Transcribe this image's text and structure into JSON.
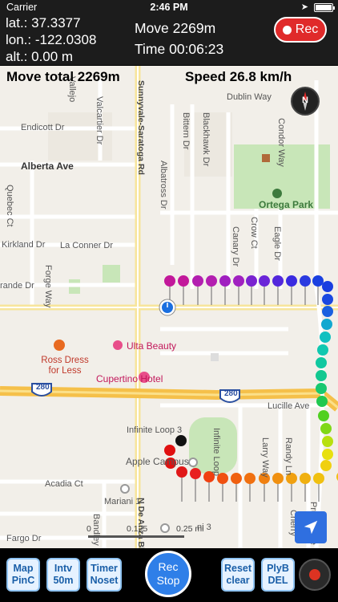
{
  "status_bar": {
    "carrier": "Carrier",
    "time": "2:46 PM"
  },
  "gps": {
    "lat": "lat.: 37.3377",
    "lon": "lon.: -122.0308",
    "alt": "alt.: 0.00 m"
  },
  "session": {
    "move": "Move 2269m",
    "time": "Time 00:06:23",
    "move_total": "Move total 2269m",
    "speed": "Speed 26.8 km/h"
  },
  "rec_button": {
    "label": "Rec"
  },
  "compass": {
    "label": "N"
  },
  "scale": {
    "l0": "0",
    "l1": "0.125",
    "l2": "0.25 mi"
  },
  "map": {
    "streets": {
      "endicott": "Endicott Dr",
      "alberta": "Alberta Ave",
      "kirkland": "Kirkland Dr",
      "la_conner": "La Conner Dr",
      "grande": "rande Dr",
      "quebec": "Quebec Ct",
      "forge": "Forge Way",
      "vallejo": "Vallejo",
      "valcartier": "Valcartier Dr",
      "sunnyvale_saratoga": "Sunnyvale-Saratoga Rd",
      "albatross": "Albatross Dr",
      "bittern": "Bittern Dr",
      "blackhawk": "Blackhawk Dr",
      "dublin": "Dublin Way",
      "condor": "Condor Way",
      "crow": "Crow Ct",
      "canary": "Canary Dr",
      "eagle": "Eagle Dr",
      "lucille": "Lucille Ave",
      "acadia": "Acadia Ct",
      "mariani": "Mariani 1",
      "infinite_loop_3": "Infinite Loop 3",
      "infinite_loop": "Infinite Loop",
      "apple_campus": "Apple Campus",
      "fargo": "Fargo Dr",
      "bandley": "Bandley Dr",
      "de_anza": "N De Anza Blvd",
      "larry": "Larry Way",
      "randy": "Randy Ln",
      "cherry": "Cherry",
      "pruneridge": "Pruneridge",
      "hwy": "280",
      "hwy2": "280",
      "mariani3": "ni 3"
    },
    "pois": {
      "ortega_park": "Ortega Park",
      "ross": "Ross Dress for Less",
      "ulta": "Ulta Beauty",
      "cupertino_hotel": "Cupertino Hotel"
    }
  },
  "toolbar": {
    "map_pinc": [
      "Map",
      "PinC"
    ],
    "intv": [
      "Intv",
      "50m"
    ],
    "timer": [
      "Timer",
      "Noset"
    ],
    "rec_stop": [
      "Rec",
      "Stop"
    ],
    "reset": [
      "Reset",
      "clear"
    ],
    "plyb": [
      "PlyB",
      "DEL"
    ]
  },
  "colors": {
    "rec_red": "#e02a2a",
    "toolbar_blue": "#2f7fe8",
    "park_green": "#c8e6b8",
    "highway_orange": "#f5c04a"
  }
}
